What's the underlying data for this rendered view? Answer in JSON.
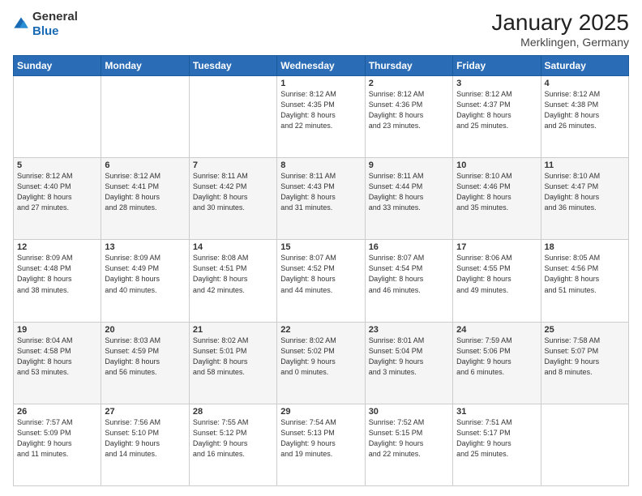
{
  "header": {
    "logo_general": "General",
    "logo_blue": "Blue",
    "month_year": "January 2025",
    "location": "Merklingen, Germany"
  },
  "days_of_week": [
    "Sunday",
    "Monday",
    "Tuesday",
    "Wednesday",
    "Thursday",
    "Friday",
    "Saturday"
  ],
  "weeks": [
    [
      {
        "day": "",
        "info": ""
      },
      {
        "day": "",
        "info": ""
      },
      {
        "day": "",
        "info": ""
      },
      {
        "day": "1",
        "info": "Sunrise: 8:12 AM\nSunset: 4:35 PM\nDaylight: 8 hours\nand 22 minutes."
      },
      {
        "day": "2",
        "info": "Sunrise: 8:12 AM\nSunset: 4:36 PM\nDaylight: 8 hours\nand 23 minutes."
      },
      {
        "day": "3",
        "info": "Sunrise: 8:12 AM\nSunset: 4:37 PM\nDaylight: 8 hours\nand 25 minutes."
      },
      {
        "day": "4",
        "info": "Sunrise: 8:12 AM\nSunset: 4:38 PM\nDaylight: 8 hours\nand 26 minutes."
      }
    ],
    [
      {
        "day": "5",
        "info": "Sunrise: 8:12 AM\nSunset: 4:40 PM\nDaylight: 8 hours\nand 27 minutes."
      },
      {
        "day": "6",
        "info": "Sunrise: 8:12 AM\nSunset: 4:41 PM\nDaylight: 8 hours\nand 28 minutes."
      },
      {
        "day": "7",
        "info": "Sunrise: 8:11 AM\nSunset: 4:42 PM\nDaylight: 8 hours\nand 30 minutes."
      },
      {
        "day": "8",
        "info": "Sunrise: 8:11 AM\nSunset: 4:43 PM\nDaylight: 8 hours\nand 31 minutes."
      },
      {
        "day": "9",
        "info": "Sunrise: 8:11 AM\nSunset: 4:44 PM\nDaylight: 8 hours\nand 33 minutes."
      },
      {
        "day": "10",
        "info": "Sunrise: 8:10 AM\nSunset: 4:46 PM\nDaylight: 8 hours\nand 35 minutes."
      },
      {
        "day": "11",
        "info": "Sunrise: 8:10 AM\nSunset: 4:47 PM\nDaylight: 8 hours\nand 36 minutes."
      }
    ],
    [
      {
        "day": "12",
        "info": "Sunrise: 8:09 AM\nSunset: 4:48 PM\nDaylight: 8 hours\nand 38 minutes."
      },
      {
        "day": "13",
        "info": "Sunrise: 8:09 AM\nSunset: 4:49 PM\nDaylight: 8 hours\nand 40 minutes."
      },
      {
        "day": "14",
        "info": "Sunrise: 8:08 AM\nSunset: 4:51 PM\nDaylight: 8 hours\nand 42 minutes."
      },
      {
        "day": "15",
        "info": "Sunrise: 8:07 AM\nSunset: 4:52 PM\nDaylight: 8 hours\nand 44 minutes."
      },
      {
        "day": "16",
        "info": "Sunrise: 8:07 AM\nSunset: 4:54 PM\nDaylight: 8 hours\nand 46 minutes."
      },
      {
        "day": "17",
        "info": "Sunrise: 8:06 AM\nSunset: 4:55 PM\nDaylight: 8 hours\nand 49 minutes."
      },
      {
        "day": "18",
        "info": "Sunrise: 8:05 AM\nSunset: 4:56 PM\nDaylight: 8 hours\nand 51 minutes."
      }
    ],
    [
      {
        "day": "19",
        "info": "Sunrise: 8:04 AM\nSunset: 4:58 PM\nDaylight: 8 hours\nand 53 minutes."
      },
      {
        "day": "20",
        "info": "Sunrise: 8:03 AM\nSunset: 4:59 PM\nDaylight: 8 hours\nand 56 minutes."
      },
      {
        "day": "21",
        "info": "Sunrise: 8:02 AM\nSunset: 5:01 PM\nDaylight: 8 hours\nand 58 minutes."
      },
      {
        "day": "22",
        "info": "Sunrise: 8:02 AM\nSunset: 5:02 PM\nDaylight: 9 hours\nand 0 minutes."
      },
      {
        "day": "23",
        "info": "Sunrise: 8:01 AM\nSunset: 5:04 PM\nDaylight: 9 hours\nand 3 minutes."
      },
      {
        "day": "24",
        "info": "Sunrise: 7:59 AM\nSunset: 5:06 PM\nDaylight: 9 hours\nand 6 minutes."
      },
      {
        "day": "25",
        "info": "Sunrise: 7:58 AM\nSunset: 5:07 PM\nDaylight: 9 hours\nand 8 minutes."
      }
    ],
    [
      {
        "day": "26",
        "info": "Sunrise: 7:57 AM\nSunset: 5:09 PM\nDaylight: 9 hours\nand 11 minutes."
      },
      {
        "day": "27",
        "info": "Sunrise: 7:56 AM\nSunset: 5:10 PM\nDaylight: 9 hours\nand 14 minutes."
      },
      {
        "day": "28",
        "info": "Sunrise: 7:55 AM\nSunset: 5:12 PM\nDaylight: 9 hours\nand 16 minutes."
      },
      {
        "day": "29",
        "info": "Sunrise: 7:54 AM\nSunset: 5:13 PM\nDaylight: 9 hours\nand 19 minutes."
      },
      {
        "day": "30",
        "info": "Sunrise: 7:52 AM\nSunset: 5:15 PM\nDaylight: 9 hours\nand 22 minutes."
      },
      {
        "day": "31",
        "info": "Sunrise: 7:51 AM\nSunset: 5:17 PM\nDaylight: 9 hours\nand 25 minutes."
      },
      {
        "day": "",
        "info": ""
      }
    ]
  ]
}
